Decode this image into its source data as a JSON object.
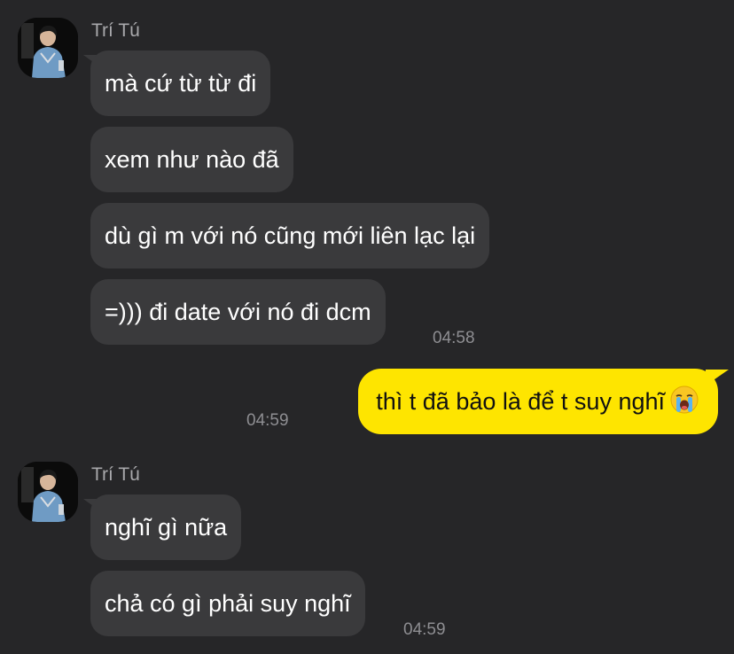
{
  "colors": {
    "background": "#262628",
    "incoming_bubble": "#3a3a3c",
    "outgoing_bubble": "#fee500",
    "timestamp": "#8e8e92",
    "sender_name": "#a8a8ab"
  },
  "groups": [
    {
      "sender": "Trí Tú",
      "avatar_icon": "profile-photo",
      "messages": [
        "mà cứ từ từ đi",
        "xem như nào đã",
        "dù gì m với nó cũng mới liên lạc lại",
        "=))) đi date với nó đi dcm"
      ],
      "time": "04:58"
    },
    {
      "outgoing": true,
      "message": "thì t đã bảo là để t suy nghĩ",
      "emoji_icon": "loudly-crying-face-emoji",
      "time": "04:59"
    },
    {
      "sender": "Trí Tú",
      "avatar_icon": "profile-photo",
      "messages": [
        "nghĩ gì nữa",
        "chả có gì phải suy nghĩ"
      ],
      "time": "04:59"
    }
  ]
}
